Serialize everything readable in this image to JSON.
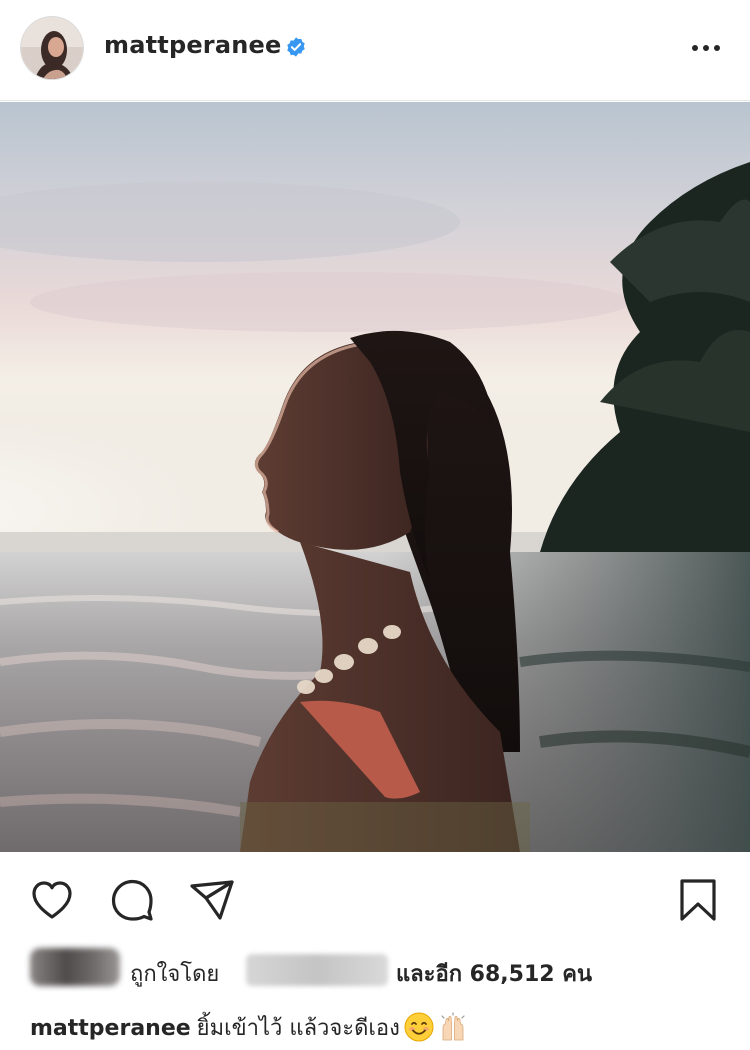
{
  "post": {
    "username": "mattperanee",
    "verified": true,
    "more_menu": "more-options-icon"
  },
  "actions": {
    "like": "heart-icon",
    "comment": "comment-bubble-icon",
    "share": "paper-plane-icon",
    "save": "bookmark-icon"
  },
  "likes": {
    "liked_by": "ถูกใจโดย",
    "and_others": "และอีก 68,512 คน"
  },
  "caption": {
    "username": "mattperanee",
    "text": "ยิ้มเข้าไว้ แล้วจะดีเอง",
    "emojis": [
      "smiling-face-emoji",
      "raised-hands-emoji"
    ]
  },
  "colors": {
    "verified_blue": "#3897f0",
    "text": "#262626",
    "divider": "#e6e6e6"
  }
}
